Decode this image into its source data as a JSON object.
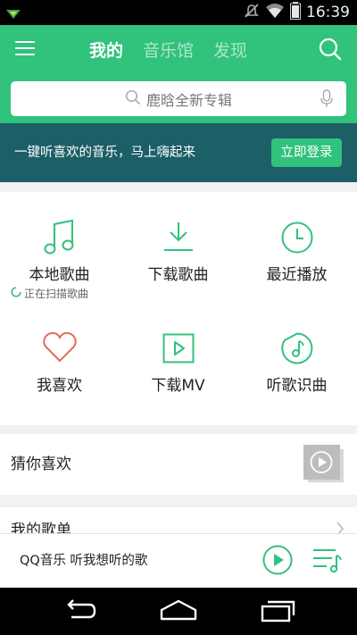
{
  "status_bar": {
    "time": "16:39",
    "icons": [
      "app-notification-icon",
      "mute-icon",
      "wifi-icon",
      "battery-icon"
    ]
  },
  "header": {
    "tabs": [
      {
        "label": "我的",
        "active": true
      },
      {
        "label": "音乐馆",
        "active": false
      },
      {
        "label": "发现",
        "active": false
      }
    ]
  },
  "search": {
    "placeholder": "鹿晗全新专辑"
  },
  "login_banner": {
    "text": "一键听喜欢的音乐，马上嗨起来",
    "button_label": "立即登录"
  },
  "grid": {
    "items": [
      {
        "label": "本地歌曲",
        "icon": "music-note-icon"
      },
      {
        "label": "下载歌曲",
        "icon": "download-icon"
      },
      {
        "label": "最近播放",
        "icon": "clock-icon"
      },
      {
        "label": "我喜欢",
        "icon": "heart-icon"
      },
      {
        "label": "下载MV",
        "icon": "mv-icon"
      },
      {
        "label": "听歌识曲",
        "icon": "song-recognition-icon"
      }
    ],
    "scan_status": "正在扫描歌曲"
  },
  "guess": {
    "label": "猜你喜欢"
  },
  "playlist": {
    "label": "我的歌单"
  },
  "mini_player": {
    "text": "QQ音乐 听我想听的歌"
  },
  "colors": {
    "brand_green": "#31c27c",
    "banner_teal": "#1c5f66",
    "heart_red": "#e5695d"
  }
}
